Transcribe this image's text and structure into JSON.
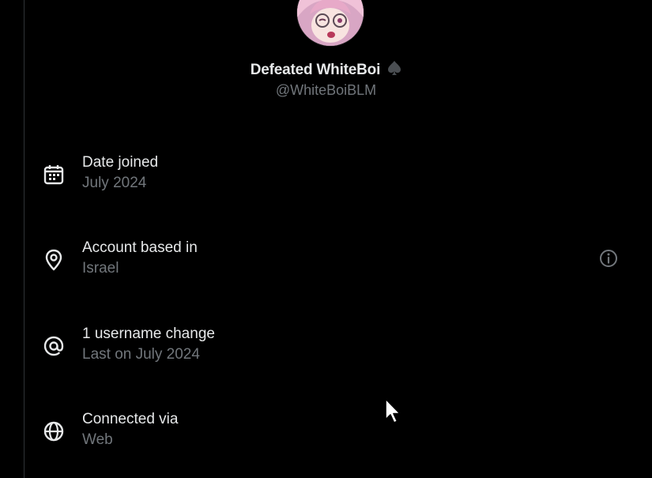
{
  "profile": {
    "display_name": "Defeated WhiteBoi",
    "handle": "@WhiteBoiBLM"
  },
  "about": {
    "items": [
      {
        "label": "Date joined",
        "value": "July 2024",
        "icon": "calendar-icon"
      },
      {
        "label": "Account based in",
        "value": "Israel",
        "icon": "location-pin-icon"
      },
      {
        "label": "1 username change",
        "value": "Last on July 2024",
        "icon": "at-sign-icon"
      },
      {
        "label": "Connected via",
        "value": "Web",
        "icon": "globe-icon"
      }
    ]
  },
  "colors": {
    "background": "#000000",
    "primary_text": "#e7e9ea",
    "secondary_text": "#71767b",
    "border": "#2f3336"
  }
}
